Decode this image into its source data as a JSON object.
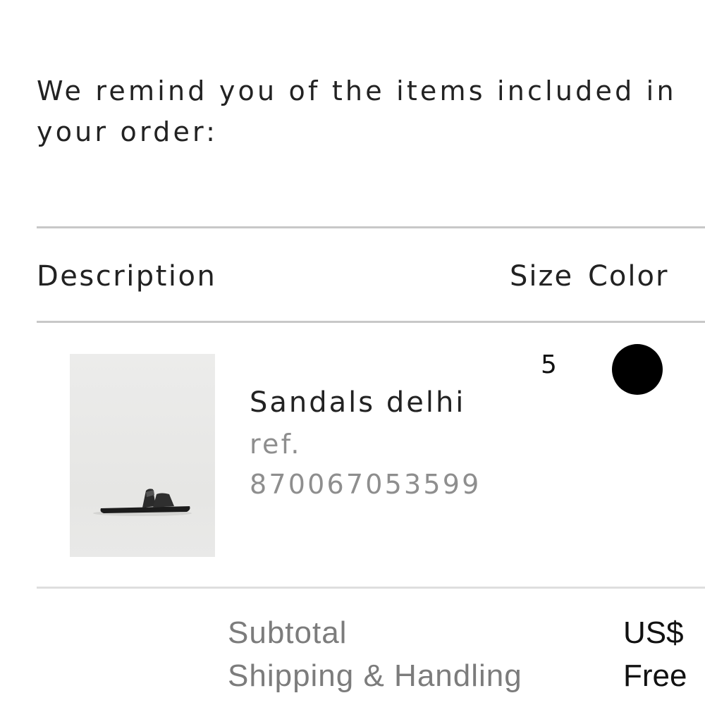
{
  "intro": {
    "line1": "We remind you of the items included in",
    "line2": "your order:"
  },
  "table": {
    "headers": {
      "description": "Description",
      "size": "Size",
      "color": "Color"
    },
    "items": [
      {
        "name": "Sandals delhi",
        "ref_label": "ref.",
        "ref_number": "870067053599",
        "size": "5",
        "color": "#000000",
        "image_icon": "sandal-product-image"
      }
    ]
  },
  "summary": {
    "subtotal_label": "Subtotal",
    "subtotal_value": "US$",
    "shipping_label": "Shipping & Handling",
    "shipping_value": "Free"
  }
}
